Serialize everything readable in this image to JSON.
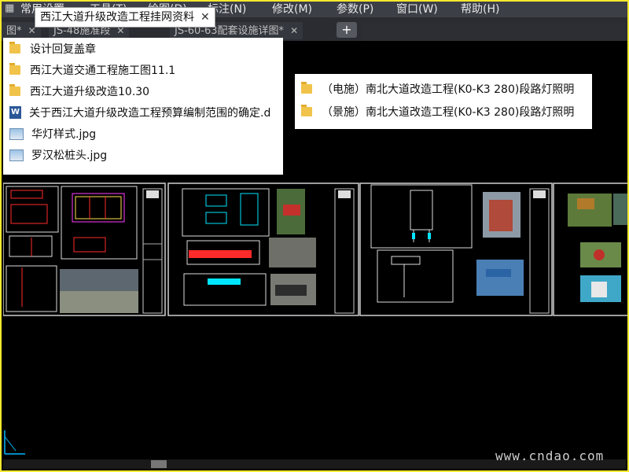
{
  "menu": [
    "常用设置",
    "工具(T)",
    "绘图(D)",
    "标注(N)",
    "修改(M)",
    "参数(P)",
    "窗口(W)",
    "帮助(H)"
  ],
  "tabs": [
    {
      "label": "图*",
      "close": "✕"
    },
    {
      "label": "JS-48施准段",
      "close": "✕"
    },
    {
      "label": "JS-60-63配套设施详图*",
      "close": "✕"
    }
  ],
  "tooltip": {
    "text": "西江大道升级改造工程挂网资料",
    "close": "✕"
  },
  "files": [
    {
      "icon": "folder-icon",
      "name": "设计回复盖章"
    },
    {
      "icon": "folder-icon",
      "name": "西江大道交通工程施工图11.1"
    },
    {
      "icon": "folder-icon",
      "name": "西江大道升级改造10.30"
    },
    {
      "icon": "word-doc-icon",
      "name": "关于西江大道升级改造工程预算编制范围的确定.d"
    },
    {
      "icon": "image-file-icon",
      "name": "华灯样式.jpg"
    },
    {
      "icon": "image-file-icon",
      "name": "罗汉松桩头.jpg"
    }
  ],
  "files2": [
    {
      "icon": "folder-icon",
      "name": "（电施）南北大道改造工程(K0-K3 280)段路灯照明"
    },
    {
      "icon": "folder-icon",
      "name": "（景施）南北大道改造工程(K0-K3 280)段路灯照明"
    }
  ],
  "plus_label": "+",
  "watermark": "www.cndao.com",
  "colors": {
    "frame": "#f7e92e",
    "menubar": "#3c3f46",
    "canvas": "#000000",
    "cad_cyan": "#00e5ff",
    "cad_red": "#ff2a2a"
  }
}
